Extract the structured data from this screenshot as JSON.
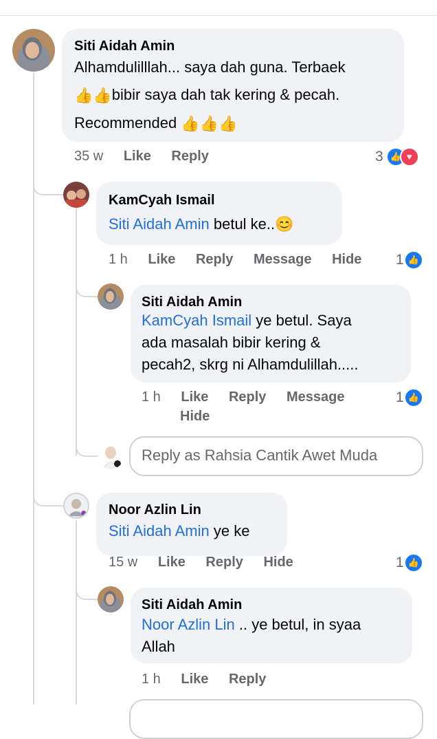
{
  "comments": [
    {
      "author": "Siti Aidah Amin",
      "text_line1": "Alhamdulilllah... saya dah guna. Terbaek",
      "text_line2_emoji": "👍👍",
      "text_line2": "bibir saya dah tak kering & pecah.",
      "text_line3": "Recommended ",
      "text_line3_emoji": "👍👍👍",
      "time": "35 w",
      "actions": [
        "Like",
        "Reply"
      ],
      "reaction_count": "3",
      "reaction_icons": [
        "like-icon",
        "love-icon"
      ]
    },
    {
      "author": "KamCyah Ismail",
      "mention": "Siti Aidah Amin",
      "text": " betul ke..",
      "emoji": "😊",
      "time": "1 h",
      "actions": [
        "Like",
        "Reply",
        "Message",
        "Hide"
      ],
      "reaction_count": "1"
    },
    {
      "author": "Siti Aidah Amin",
      "mention": "KamCyah Ismail",
      "text_line1": " ye betul. Saya",
      "text_line2": "ada masalah bibir kering &",
      "text_line3": "pecah2, skrg ni Alhamdulillah.....",
      "time": "1 h",
      "actions": [
        "Like",
        "Reply",
        "Message",
        "Hide"
      ],
      "reaction_count": "1"
    },
    {
      "author": "Noor Azlin Lin",
      "mention": "Siti Aidah Amin",
      "text": " ye ke",
      "time": "15 w",
      "actions": [
        "Like",
        "Reply",
        "Hide"
      ],
      "reaction_count": "1"
    },
    {
      "author": "Siti Aidah Amin",
      "mention": "Noor Azlin Lin",
      "text_line1": " .. ye betul, in syaa",
      "text_line2": "Allah",
      "time": "1 h",
      "actions": [
        "Like",
        "Reply"
      ]
    }
  ],
  "reply_box": {
    "placeholder": "Reply as Rahsia Cantik Awet Muda"
  },
  "colors": {
    "bubble": "#f0f2f5",
    "mention": "#216fdb",
    "like_blue": "#1877f2",
    "love_red": "#f33e58"
  }
}
